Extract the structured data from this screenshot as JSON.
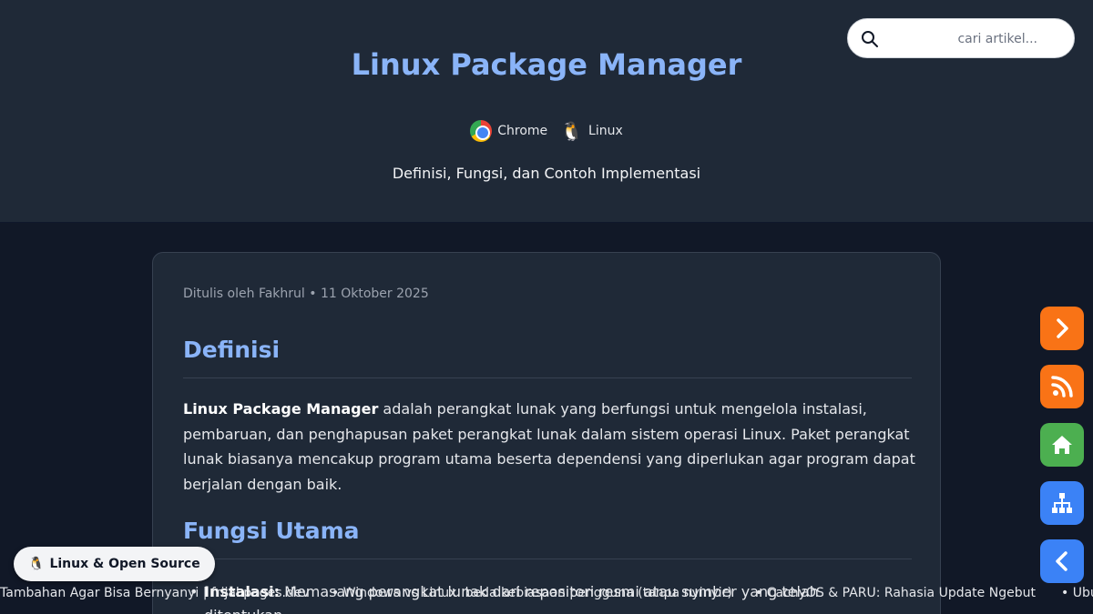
{
  "header": {
    "title": "Linux Package Manager",
    "tags": [
      "Chrome",
      "Linux"
    ],
    "subtitle": "Definisi, Fungsi, dan Contoh Implementasi"
  },
  "search": {
    "placeholder": "cari artikel..."
  },
  "article": {
    "meta": "Ditulis oleh Fakhrul • 11 Oktober 2025",
    "section1_title": "Definisi",
    "para_bold": "Linux Package Manager",
    "para_text": " adalah perangkat lunak yang berfungsi untuk mengelola instalasi, pembaruan, dan penghapusan paket perangkat lunak dalam sistem operasi Linux. Paket perangkat lunak biasanya mencakup program utama beserta dependensi yang diperlukan agar program dapat berjalan dengan baik.",
    "section2_title": "Fungsi Utama",
    "list_bold": "Instalasi:",
    "list_text": " Memasang perangkat lunak dari repositori resmi atau sumber yang telah ditentukan."
  },
  "badge": {
    "label": "Linux & Open Source"
  },
  "ticker": [
    "Tambahan Agar Bisa Bernyanyi | frijal.pages.dev",
    "• Windows vs Linux: beda kebiasaan pengguna (tanpa nyinyir)",
    "• CachyOS & PARU: Rahasia Update Ngebut",
    "• Ubu"
  ],
  "side_buttons": [
    {
      "icon": "chevron-right-icon",
      "color": "#f97316"
    },
    {
      "icon": "rss-icon",
      "color": "#f97316"
    },
    {
      "icon": "home-icon",
      "color": "#4caf50"
    },
    {
      "icon": "sitemap-icon",
      "color": "#3b82f6"
    },
    {
      "icon": "chevron-left-icon",
      "color": "#3b82f6"
    }
  ]
}
